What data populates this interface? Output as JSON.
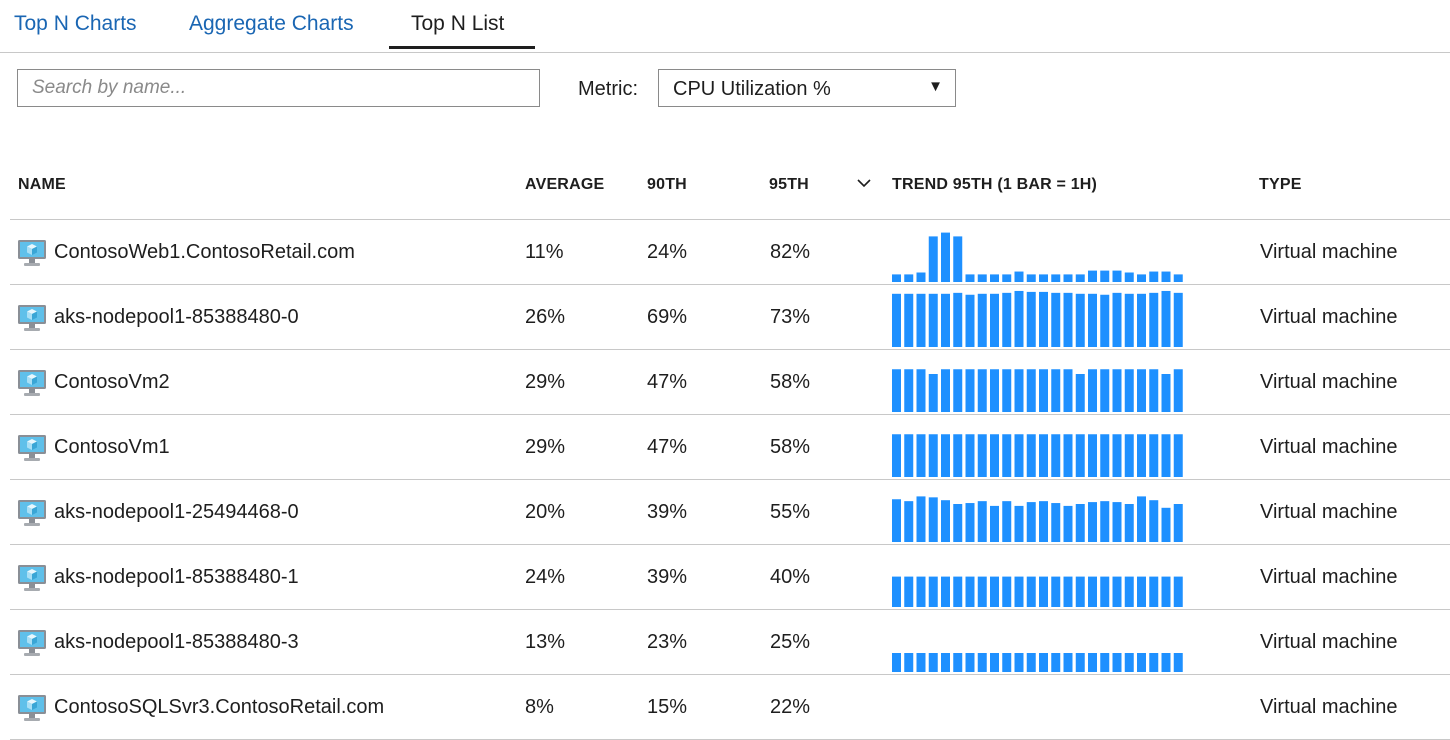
{
  "tabs": [
    {
      "label": "Top N Charts",
      "active": false
    },
    {
      "label": "Aggregate Charts",
      "active": false
    },
    {
      "label": "Top N List",
      "active": true
    }
  ],
  "search": {
    "placeholder": "Search by name...",
    "value": ""
  },
  "metric": {
    "label": "Metric:",
    "selected": "CPU Utilization %"
  },
  "colors": {
    "accent": "#1a66b3",
    "bar": "#1e90ff",
    "border": "#c8c8c8"
  },
  "table": {
    "columns": {
      "name": "NAME",
      "average": "AVERAGE",
      "p90": "90TH",
      "p95": "95TH",
      "trend": "TREND 95TH (1 BAR = 1H)",
      "type": "TYPE"
    },
    "sort_icon": "chevron-down-icon",
    "rows": [
      {
        "icon": "virtual-machine-icon",
        "name": "ContosoWeb1.ContosoRetail.com",
        "average": "11%",
        "p90": "24%",
        "p95": "82%",
        "type": "Virtual machine",
        "trend": [
          8,
          8,
          10,
          48,
          52,
          48,
          8,
          8,
          8,
          8,
          11,
          8,
          8,
          8,
          8,
          8,
          12,
          12,
          12,
          10,
          8,
          11,
          11,
          8
        ]
      },
      {
        "icon": "virtual-machine-icon",
        "name": "aks-nodepool1-85388480-0",
        "average": "26%",
        "p90": "69%",
        "p95": "73%",
        "type": "Virtual machine",
        "trend": [
          56,
          56,
          56,
          56,
          56,
          57,
          55,
          56,
          56,
          57,
          59,
          58,
          58,
          57,
          57,
          56,
          56,
          55,
          57,
          56,
          56,
          57,
          59,
          57
        ]
      },
      {
        "icon": "virtual-machine-icon",
        "name": "ContosoVm2",
        "average": "29%",
        "p90": "47%",
        "p95": "58%",
        "type": "Virtual machine",
        "trend": [
          45,
          45,
          45,
          40,
          45,
          45,
          45,
          45,
          45,
          45,
          45,
          45,
          45,
          45,
          45,
          40,
          45,
          45,
          45,
          45,
          45,
          45,
          40,
          45
        ]
      },
      {
        "icon": "virtual-machine-icon",
        "name": "ContosoVm1",
        "average": "29%",
        "p90": "47%",
        "p95": "58%",
        "type": "Virtual machine",
        "trend": [
          45,
          45,
          45,
          45,
          45,
          45,
          45,
          45,
          45,
          45,
          45,
          45,
          45,
          45,
          45,
          45,
          45,
          45,
          45,
          45,
          45,
          45,
          45,
          45
        ]
      },
      {
        "icon": "virtual-machine-icon",
        "name": "aks-nodepool1-25494468-0",
        "average": "20%",
        "p90": "39%",
        "p95": "55%",
        "type": "Virtual machine",
        "trend": [
          45,
          43,
          48,
          47,
          44,
          40,
          41,
          43,
          38,
          43,
          38,
          42,
          43,
          41,
          38,
          40,
          42,
          43,
          42,
          40,
          48,
          44,
          36,
          40
        ]
      },
      {
        "icon": "virtual-machine-icon",
        "name": "aks-nodepool1-85388480-1",
        "average": "24%",
        "p90": "39%",
        "p95": "40%",
        "type": "Virtual machine",
        "trend": [
          32,
          32,
          32,
          32,
          32,
          32,
          32,
          32,
          32,
          32,
          32,
          32,
          32,
          32,
          32,
          32,
          32,
          32,
          32,
          32,
          32,
          32,
          32,
          32
        ]
      },
      {
        "icon": "virtual-machine-icon",
        "name": "aks-nodepool1-85388480-3",
        "average": "13%",
        "p90": "23%",
        "p95": "25%",
        "type": "Virtual machine",
        "trend": [
          20,
          20,
          20,
          20,
          20,
          20,
          20,
          20,
          20,
          20,
          20,
          20,
          20,
          20,
          20,
          20,
          20,
          20,
          20,
          20,
          20,
          20,
          20,
          20
        ]
      },
      {
        "icon": "virtual-machine-icon",
        "name": "ContosoSQLSvr3.ContosoRetail.com",
        "average": "8%",
        "p90": "15%",
        "p95": "22%",
        "type": "Virtual machine",
        "trend": []
      }
    ]
  }
}
